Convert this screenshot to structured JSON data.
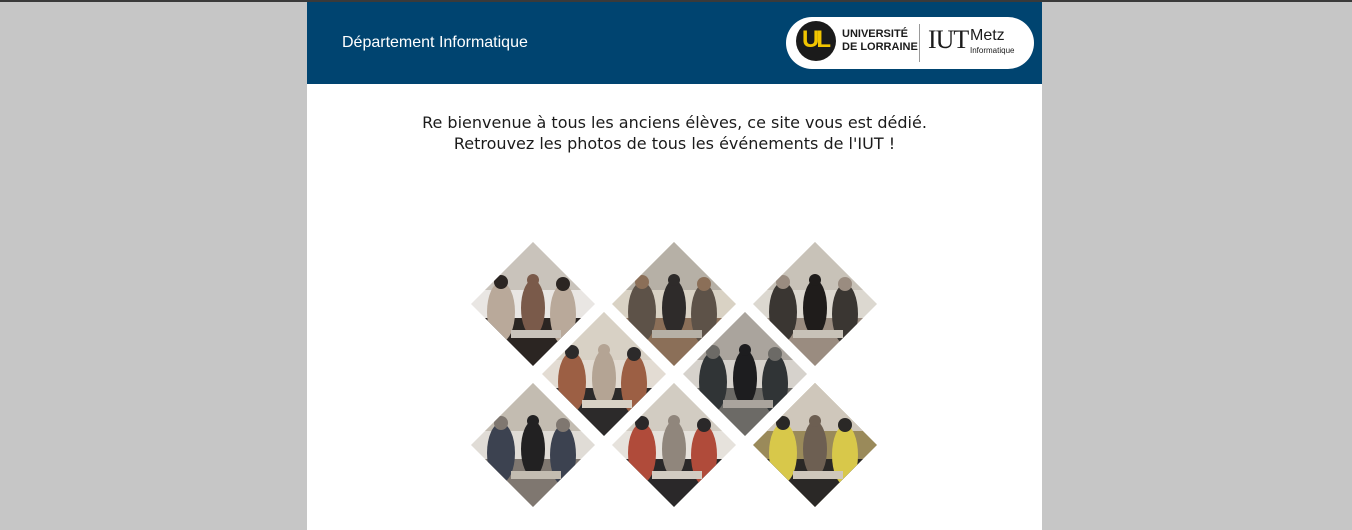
{
  "header": {
    "department": "Département Informatique",
    "logo": {
      "ul_mark": "UL",
      "ul_line1": "UNIVERSITÉ",
      "ul_line2": "DE LORRAINE",
      "iut": "IUT",
      "city": "Metz",
      "sub": "Informatique"
    }
  },
  "welcome": {
    "line1": "Re bienvenue à tous les anciens élèves, ce site vous est dédié.",
    "line2": "Retrouvez les photos de tous les événements de l'IUT !"
  },
  "gallery": {
    "photos": [
      {
        "name": "event-photo-1",
        "palette": [
          "#e9e6e3",
          "#b9a99a",
          "#2b2522",
          "#7a5a4a",
          "#c9c3bb"
        ]
      },
      {
        "name": "event-photo-2",
        "palette": [
          "#d9d2c4",
          "#5d5248",
          "#8b6f58",
          "#2e2b2a",
          "#b6b0a6"
        ]
      },
      {
        "name": "event-photo-3",
        "palette": [
          "#dcd8d0",
          "#3a3632",
          "#9a8c80",
          "#1f1c1b",
          "#c8c2b8"
        ]
      },
      {
        "name": "event-photo-4",
        "palette": [
          "#e3dcd3",
          "#9c5f44",
          "#2c2a2a",
          "#b4a494",
          "#d8d1c5"
        ]
      },
      {
        "name": "event-photo-5",
        "palette": [
          "#d6d2cc",
          "#303436",
          "#6c6a66",
          "#1d1d1f",
          "#aaa49d"
        ]
      },
      {
        "name": "event-photo-6",
        "palette": [
          "#e0dcd6",
          "#3c4250",
          "#7f7770",
          "#222122",
          "#c3bcb1"
        ]
      },
      {
        "name": "event-photo-7",
        "palette": [
          "#e6e2dc",
          "#b04b3a",
          "#2a2829",
          "#90867c",
          "#d2ccc2"
        ]
      },
      {
        "name": "event-photo-8",
        "palette": [
          "#9a8a5a",
          "#d8c84a",
          "#2a2826",
          "#6d5f52",
          "#cfc7bb"
        ]
      }
    ]
  }
}
